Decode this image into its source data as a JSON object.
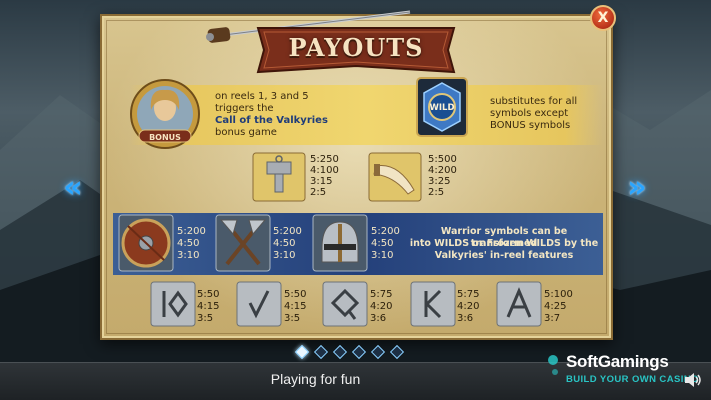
{
  "header": {
    "title": "PAYOUTS",
    "close_label": "X"
  },
  "bonus": {
    "icon_label": "BONUS",
    "line1": "on reels 1, 3 and 5",
    "line2": "triggers the",
    "line3": "Call of the Valkyries",
    "line4": "bonus game"
  },
  "wild": {
    "icon_label": "WILD",
    "line1": "substitutes for all",
    "line2": "symbols except",
    "line3": "BONUS symbols"
  },
  "high_symbols": [
    {
      "name": "hammer-pendant",
      "pays": [
        "5:250",
        "4:100",
        "3:15",
        "2:5"
      ]
    },
    {
      "name": "drinking-horn",
      "pays": [
        "5:500",
        "4:200",
        "3:25",
        "2:5"
      ]
    }
  ],
  "warrior_symbols": [
    {
      "name": "shield",
      "pays": [
        "5:200",
        "4:50",
        "3:10"
      ]
    },
    {
      "name": "crossed-axes",
      "pays": [
        "5:200",
        "4:50",
        "3:10"
      ]
    },
    {
      "name": "helmet",
      "pays": [
        "5:200",
        "4:50",
        "3:10"
      ]
    }
  ],
  "warrior_note": {
    "line1": "Warrior symbols can be transformed",
    "line2": "into WILDS or Frozen WILDS by the",
    "line3": "Valkyries' in-reel features"
  },
  "rune_symbols": [
    {
      "name": "rune-10",
      "pays": [
        "5:50",
        "4:15",
        "3:5"
      ]
    },
    {
      "name": "rune-j",
      "pays": [
        "5:50",
        "4:15",
        "3:5"
      ]
    },
    {
      "name": "rune-q",
      "pays": [
        "5:75",
        "4:20",
        "3:6"
      ]
    },
    {
      "name": "rune-k",
      "pays": [
        "5:75",
        "4:20",
        "3:6"
      ]
    },
    {
      "name": "rune-a",
      "pays": [
        "5:100",
        "4:25",
        "3:7"
      ]
    }
  ],
  "pagination": {
    "pages": 6,
    "active": 0
  },
  "footer": {
    "status": "Playing for fun",
    "brand_name": "SoftGamings",
    "brand_tagline": "BUILD YOUR OWN CASINO"
  },
  "colors": {
    "nav_arrow": "#2aa5ff",
    "brand_accent": "#29c4c4",
    "banner": "#7a2e1b"
  }
}
